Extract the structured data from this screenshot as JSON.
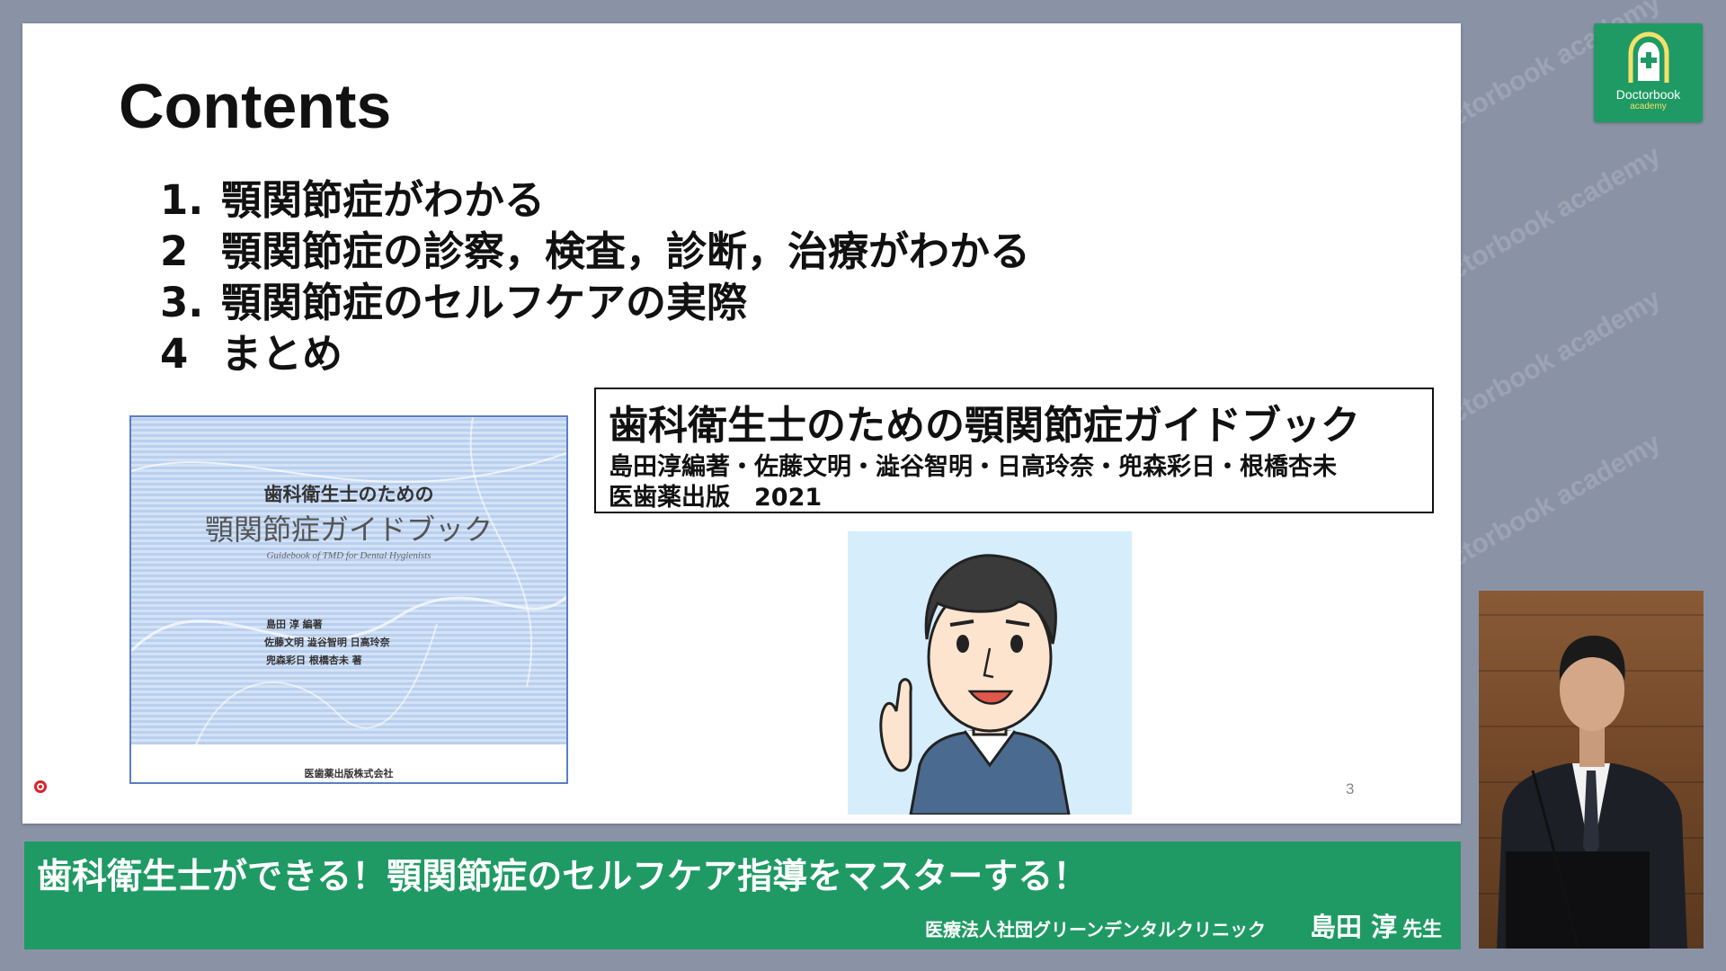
{
  "slide": {
    "title": "Contents",
    "toc": [
      {
        "num": "1.",
        "text": "顎関節症がわかる"
      },
      {
        "num": "2",
        "text": "顎関節症の診察，検査，診断，治療がわかる"
      },
      {
        "num": "3.",
        "text": "顎関節症のセルフケアの実際"
      },
      {
        "num": "4",
        "text": "まとめ"
      }
    ],
    "book_cover": {
      "super_title": "歯科衛生士のための",
      "main_title": "顎関節症ガイドブック",
      "english_title": "Guidebook of TMD for Dental Hygienists",
      "author_lines": [
        "島田 淳 編著",
        "佐藤文明 澁谷智明 日高玲奈",
        "兜森彩日 根橋杏未 著"
      ],
      "publisher": "医歯薬出版株式会社"
    },
    "reference": {
      "title": "歯科衛生士のための顎関節症ガイドブック",
      "authors": "島田淳編著・佐藤文明・澁谷智明・日高玲奈・兜森彩日・根橋杏未",
      "publisher_year": "医歯薬出版　2021"
    },
    "page_number": "3"
  },
  "lower_third": {
    "title": "歯科衛生士ができる！顎関節症のセルフケア指導をマスターする！",
    "clinic": "医療法人社団グリーンデンタルクリニック",
    "presenter_name": "島田 淳",
    "presenter_suffix": "先生"
  },
  "logo": {
    "name": "Doctorbook",
    "sub": "academy"
  },
  "watermark_text": "Doctorbook academy",
  "colors": {
    "brand_green": "#1f9a64",
    "background": "#8a93a6",
    "logo_sub_text": "#f4e06a"
  },
  "icons": [
    "doctorbook-logo-icon",
    "laser-pointer-icon"
  ]
}
